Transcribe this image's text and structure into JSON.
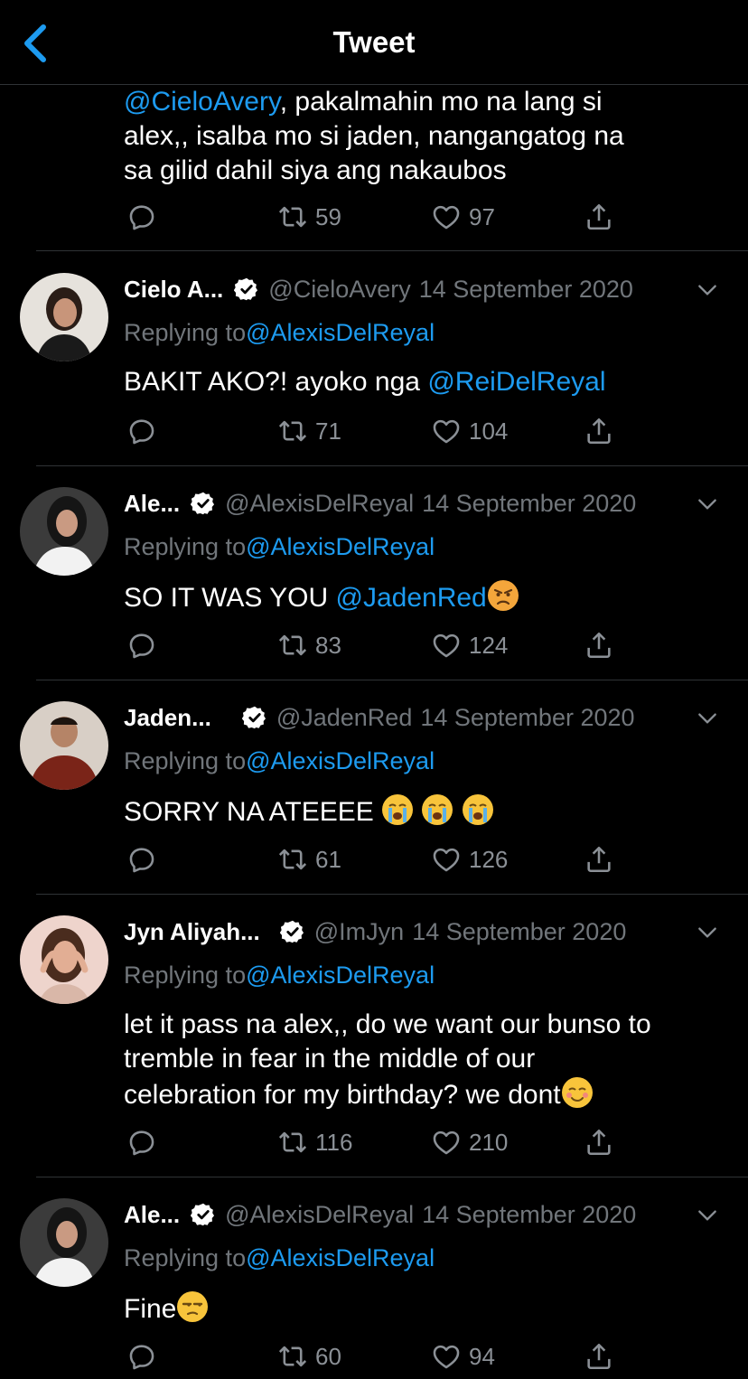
{
  "header": {
    "title": "Tweet"
  },
  "top_tweet": {
    "mention": "@CieloAvery",
    "line1_rest": ", pakalmahin mo na lang si",
    "line2": "alex,, isalba mo si jaden, nangangatog na",
    "line3": "sa gilid dahil siya ang nakaubos",
    "retweets": "59",
    "likes": "97"
  },
  "tweets": [
    {
      "name": "Cielo A...",
      "handle": "@CieloAvery",
      "date": "14 September 2020",
      "replying_label": "Replying to",
      "replying_handle": "@AlexisDelReyal",
      "text_before": "BAKIT AKO?! ayoko nga ",
      "mention": "@ReiDelReyal",
      "retweets": "71",
      "likes": "104"
    },
    {
      "name": "Ale...",
      "handle": "@AlexisDelReyal",
      "date": "14 September 2020",
      "replying_label": "Replying to",
      "replying_handle": "@AlexisDelReyal",
      "text_before": "SO IT WAS YOU ",
      "mention": "@JadenRed",
      "emoji": "angry-face",
      "retweets": "83",
      "likes": "124"
    },
    {
      "name": "Jaden...",
      "handle": "@JadenRed",
      "date": "14 September 2020",
      "replying_label": "Replying to",
      "replying_handle": "@AlexisDelReyal",
      "text_before": "SORRY NA ATEEEE ",
      "emoji": "loudly-crying-face",
      "retweets": "61",
      "likes": "126"
    },
    {
      "name": "Jyn Aliyah...",
      "handle": "@ImJyn",
      "date": "14 September 2020",
      "replying_label": "Replying to",
      "replying_handle": "@AlexisDelReyal",
      "line1": "let it pass na alex,, do we want our bunso to",
      "line2": "tremble in fear in the middle of our",
      "line3": "celebration for my birthday? we dont",
      "emoji": "smiling-face",
      "retweets": "116",
      "likes": "210"
    },
    {
      "name": "Ale...",
      "handle": "@AlexisDelReyal",
      "date": "14 September 2020",
      "replying_label": "Replying to",
      "replying_handle": "@AlexisDelReyal",
      "text_before": "Fine",
      "emoji": "unamused-face",
      "retweets": "60",
      "likes": "94"
    }
  ],
  "colors": {
    "background": "#000000",
    "link": "#1d9bf0",
    "muted": "#71767b",
    "separator": "#2f3336"
  }
}
